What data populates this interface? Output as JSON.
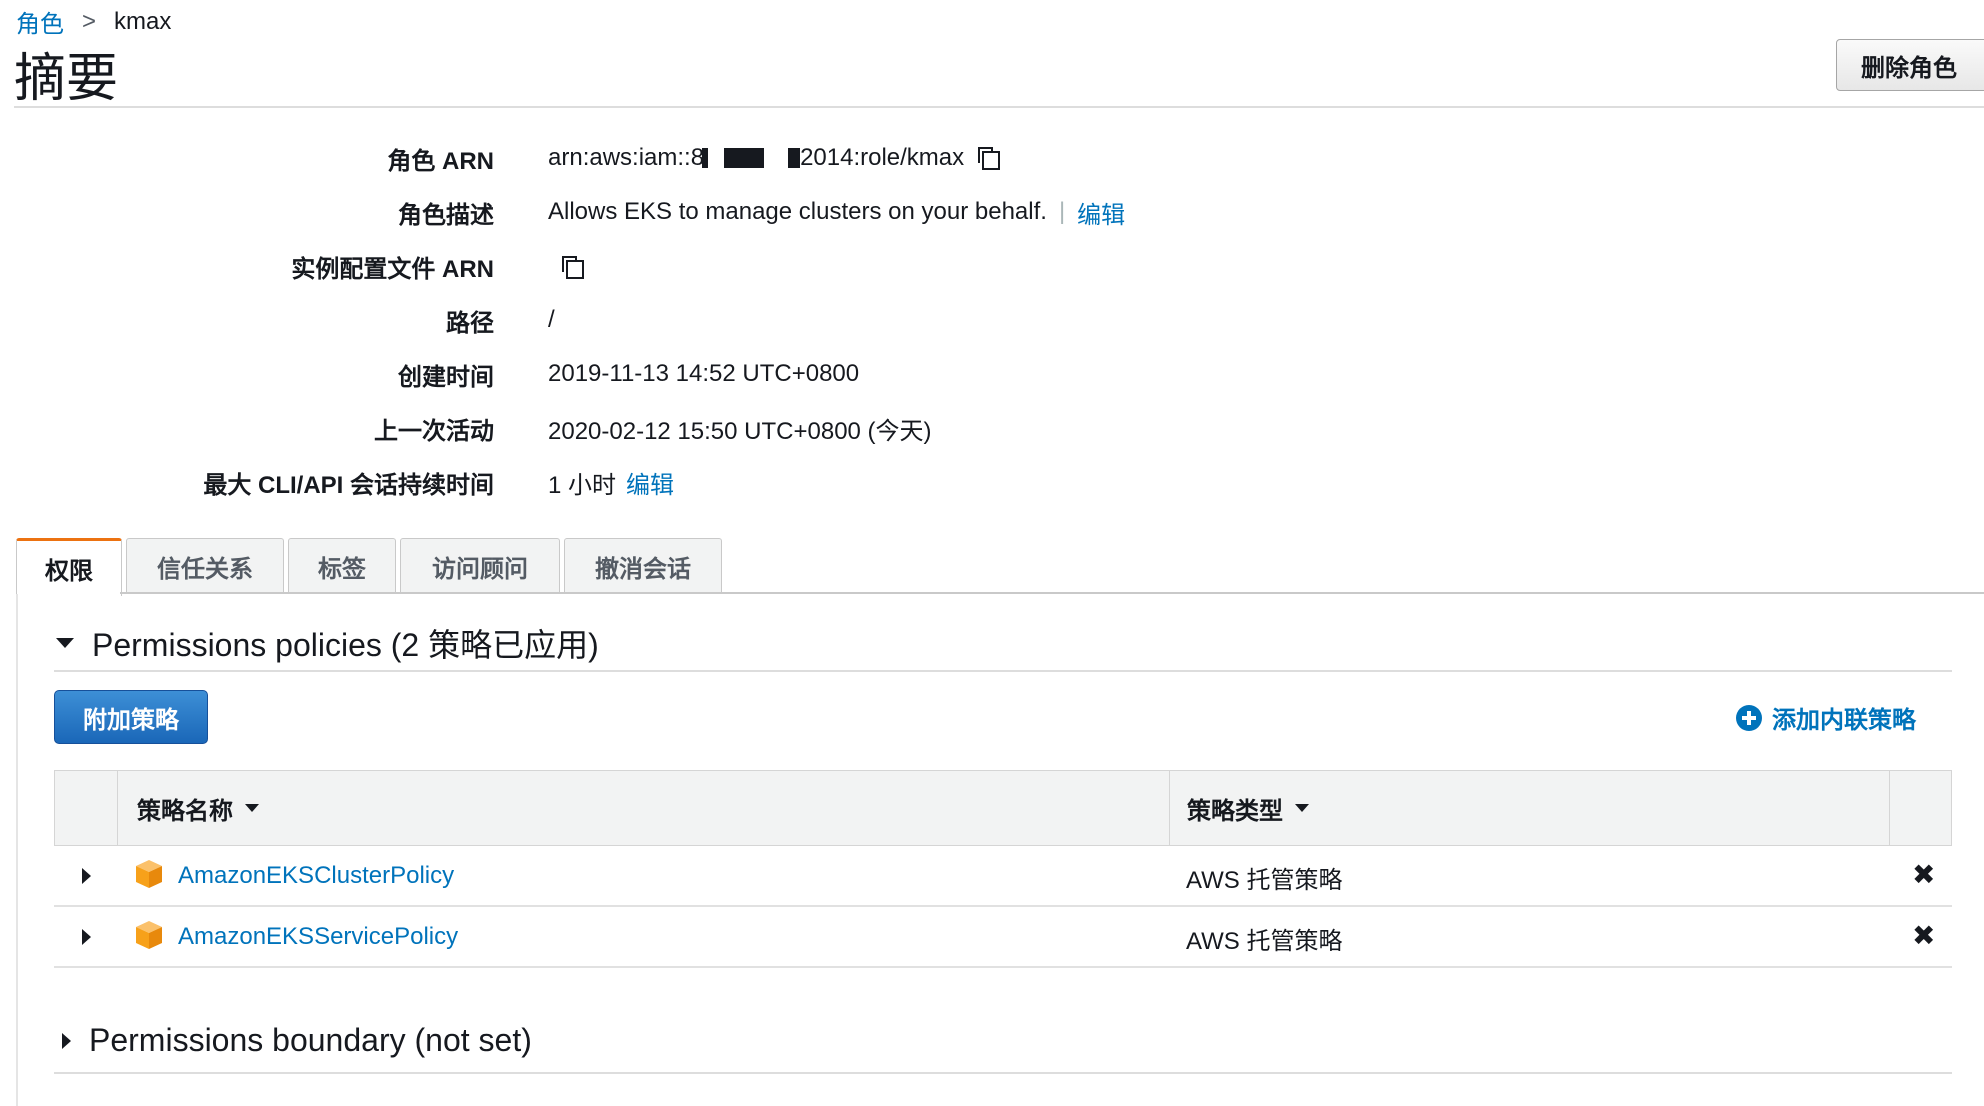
{
  "breadcrumb": {
    "parent": "角色",
    "separator": ">",
    "current": "kmax"
  },
  "page": {
    "title": "摘要",
    "delete_button": "删除角色"
  },
  "summary": {
    "role_arn": {
      "label": "角色 ARN",
      "prefix": "arn:aws:iam::8",
      "suffix": "2014:role/kmax"
    },
    "role_description": {
      "label": "角色描述",
      "value": "Allows EKS to manage clusters on your behalf.",
      "edit": "编辑"
    },
    "instance_profile_arn": {
      "label": "实例配置文件 ARN"
    },
    "path": {
      "label": "路径",
      "value": "/"
    },
    "creation_time": {
      "label": "创建时间",
      "value": "2019-11-13 14:52 UTC+0800"
    },
    "last_activity": {
      "label": "上一次活动",
      "value": "2020-02-12 15:50 UTC+0800 (今天)"
    },
    "max_session": {
      "label": "最大 CLI/API 会话持续时间",
      "value": "1 小时",
      "edit": "编辑"
    }
  },
  "tabs": [
    {
      "label": "权限",
      "active": true
    },
    {
      "label": "信任关系",
      "active": false
    },
    {
      "label": "标签",
      "active": false
    },
    {
      "label": "访问顾问",
      "active": false
    },
    {
      "label": "撤消会话",
      "active": false
    }
  ],
  "permissions": {
    "section_title": "Permissions policies (2 策略已应用)",
    "attach_button": "附加策略",
    "add_inline_policy": "添加内联策略",
    "columns": {
      "name": "策略名称",
      "type": "策略类型"
    },
    "policies": [
      {
        "name": "AmazonEKSClusterPolicy",
        "type": "AWS 托管策略",
        "remove": "✖"
      },
      {
        "name": "AmazonEKSServicePolicy",
        "type": "AWS 托管策略",
        "remove": "✖"
      }
    ],
    "boundary_title": "Permissions boundary (not set)"
  },
  "colors": {
    "link": "#0073bb",
    "tab_accent": "#ec7211",
    "primary_button": "#1a67b8",
    "box_icon": "#f7a11a"
  },
  "icons": {
    "copy": "copy-icon",
    "box": "aws-managed-policy-box-icon",
    "add": "plus-circle-icon",
    "remove": "close-icon"
  }
}
